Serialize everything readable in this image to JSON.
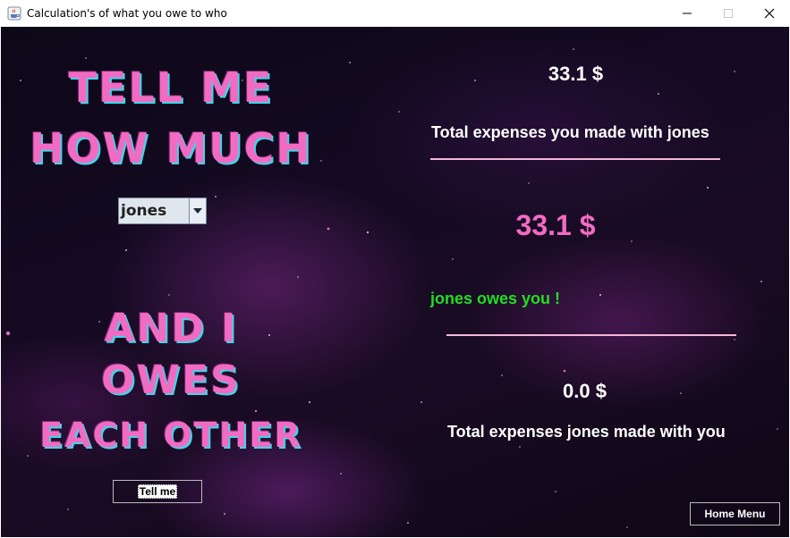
{
  "window": {
    "title": "Calculation's of what you owe to who",
    "icon": "java-cup-icon"
  },
  "left": {
    "headline_line1": "Tell me",
    "headline_line2": "how much",
    "person_select": {
      "selected": "jones"
    },
    "subline1": "And I",
    "subline2": "owes",
    "subline3": "each other",
    "tell_me_button": "Tell me"
  },
  "right": {
    "my_total_value": "33.1 $",
    "my_total_label": "Total expenses you made with jones",
    "balance_value": "33.1 $",
    "balance_message": "jones owes you !",
    "their_total_value": "0.0 $",
    "their_total_label": "Total expenses jones made with you"
  },
  "footer": {
    "home_button": "Home Menu"
  },
  "colors": {
    "neon_pink": "#f26bc3",
    "neon_cyan": "#3fd6e8",
    "balance_pink": "#f26bc3",
    "owes_green": "#22dd22",
    "divider": "#f4b7d8"
  }
}
